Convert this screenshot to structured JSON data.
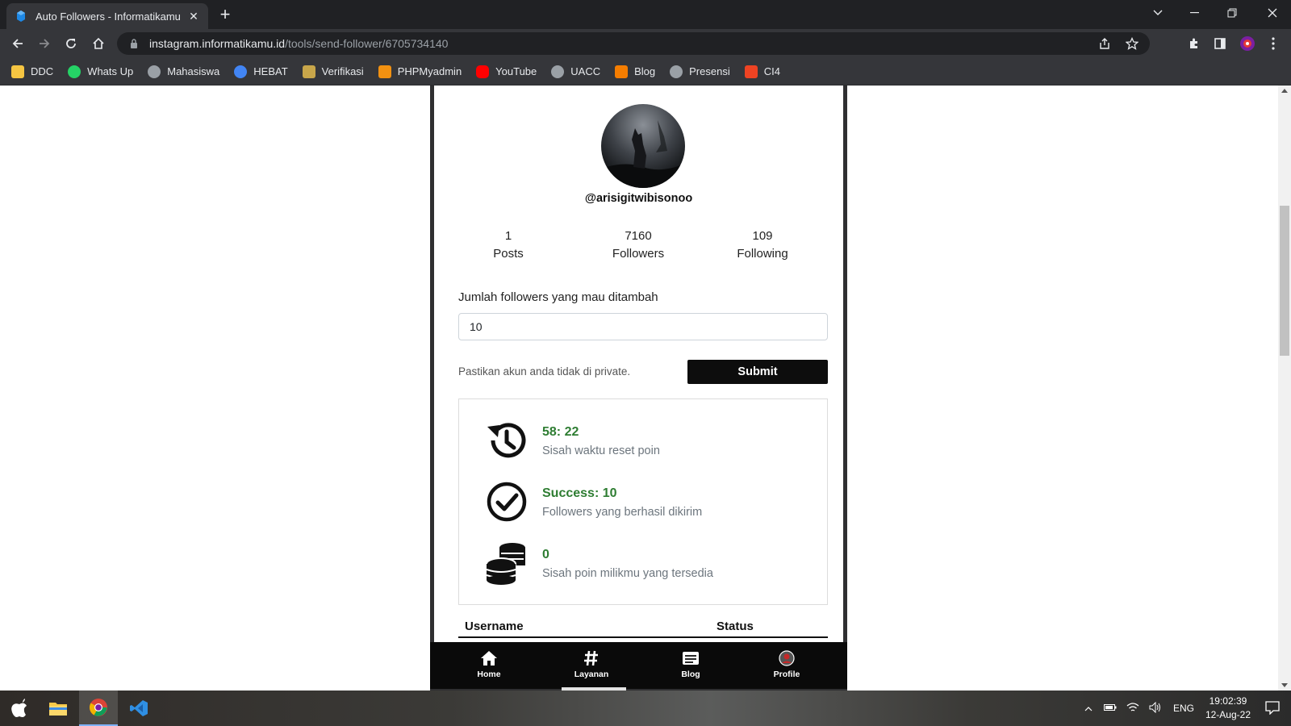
{
  "browser": {
    "tab_title": "Auto Followers - Informatikamu",
    "url_host": "instagram.informatikamu.id",
    "url_path": "/tools/send-follower/6705734140",
    "bookmarks": [
      {
        "label": "DDC",
        "icon": "folder-icon",
        "color": "#f5c542"
      },
      {
        "label": "Whats Up",
        "icon": "whatsapp-icon",
        "color": "#25d366"
      },
      {
        "label": "Mahasiswa",
        "icon": "globe-icon",
        "color": "#9aa0a6"
      },
      {
        "label": "HEBAT",
        "icon": "hebat-icon",
        "color": "#4285f4"
      },
      {
        "label": "Verifikasi",
        "icon": "garuda-icon",
        "color": "#c8a64a"
      },
      {
        "label": "PHPMyadmin",
        "icon": "phpmyadmin-icon",
        "color": "#f29111"
      },
      {
        "label": "YouTube",
        "icon": "youtube-icon",
        "color": "#ff0000"
      },
      {
        "label": "UACC",
        "icon": "globe-icon",
        "color": "#9aa0a6"
      },
      {
        "label": "Blog",
        "icon": "blogger-icon",
        "color": "#f57d00"
      },
      {
        "label": "Presensi",
        "icon": "globe-icon",
        "color": "#9aa0a6"
      },
      {
        "label": "CI4",
        "icon": "codeigniter-icon",
        "color": "#ee4323"
      }
    ]
  },
  "profile": {
    "username": "@arisigitwibisonoo",
    "stats": [
      {
        "value": "1",
        "label": "Posts"
      },
      {
        "value": "7160",
        "label": "Followers"
      },
      {
        "value": "109",
        "label": "Following"
      }
    ]
  },
  "form": {
    "label": "Jumlah followers yang mau ditambah",
    "value": "10",
    "note": "Pastikan akun anda tidak di private.",
    "submit_label": "Submit"
  },
  "info": [
    {
      "value": "58: 22",
      "desc": "Sisah waktu reset poin",
      "icon": "history-icon"
    },
    {
      "value": "Success: 10",
      "desc": "Followers yang berhasil dikirim",
      "icon": "check-circle-icon"
    },
    {
      "value": "0",
      "desc": "Sisah poin milikmu yang tersedia",
      "icon": "coins-icon"
    }
  ],
  "table": {
    "headers": [
      "Username",
      "Status"
    ]
  },
  "bottom_nav": [
    {
      "label": "Home",
      "icon": "home-icon"
    },
    {
      "label": "Layanan",
      "icon": "hashtag-icon"
    },
    {
      "label": "Blog",
      "icon": "blog-icon"
    },
    {
      "label": "Profile",
      "icon": "profile-avatar-icon"
    }
  ],
  "taskbar": {
    "language": "ENG",
    "time": "19:02:39",
    "date": "12-Aug-22"
  }
}
